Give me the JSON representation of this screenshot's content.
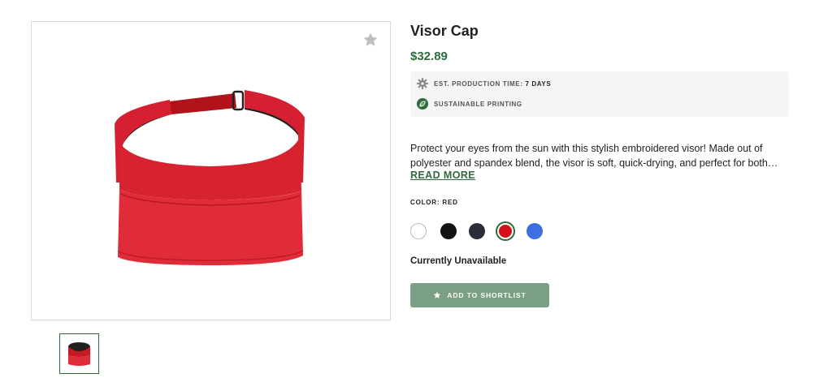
{
  "product": {
    "title": "Visor Cap",
    "price": "$32.89",
    "image_alt_icon": "visor-product-image",
    "favorite_icon": "star-icon"
  },
  "info": {
    "production_label": "EST. PRODUCTION TIME:",
    "production_value": "7 DAYS",
    "production_icon": "gear-icon",
    "sustainable_label": "SUSTAINABLE PRINTING",
    "sustainable_icon": "leaf-icon"
  },
  "description": {
    "line1": "Protect your eyes from the sun with this stylish embroidered visor! Made out of",
    "line2": "polyester and spandex blend, the visor is soft, quick-drying, and perfect for both…",
    "read_more": "READ MORE"
  },
  "color": {
    "label": "COLOR: RED",
    "selected": "red",
    "options": [
      {
        "name": "white",
        "hex": "#ffffff"
      },
      {
        "name": "black",
        "hex": "#111111"
      },
      {
        "name": "navy",
        "hex": "#2b2d3a"
      },
      {
        "name": "red",
        "hex": "#d4121b"
      },
      {
        "name": "blue",
        "hex": "#3d6fe0"
      }
    ]
  },
  "availability": "Currently Unavailable",
  "shortlist_button": {
    "label": "ADD TO SHORTLIST",
    "icon": "star-icon"
  },
  "colors": {
    "accent": "#2f6b3a",
    "button_bg": "#7a9f82",
    "info_bg": "#f5f5f5"
  }
}
